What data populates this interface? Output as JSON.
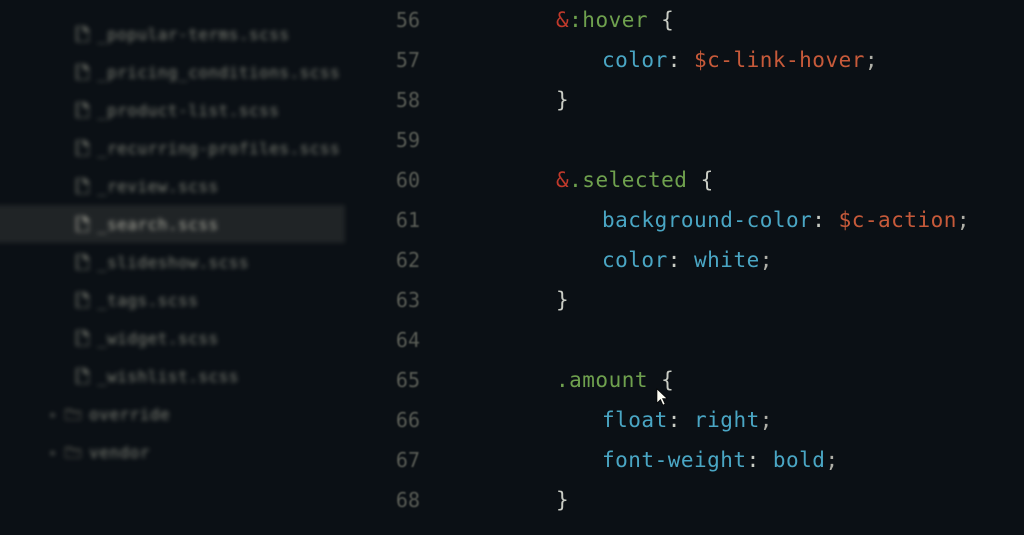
{
  "sidebar": {
    "files": [
      {
        "name": "_popular-terms.scss"
      },
      {
        "name": "_pricing_conditions.scss"
      },
      {
        "name": "_product-list.scss"
      },
      {
        "name": "_recurring-profiles.scss"
      },
      {
        "name": "_review.scss"
      },
      {
        "name": "_search.scss",
        "active": true
      },
      {
        "name": "_slideshow.scss"
      },
      {
        "name": "_tags.scss"
      },
      {
        "name": "_widget.scss"
      },
      {
        "name": "_wishlist.scss"
      }
    ],
    "folders": [
      {
        "name": "override"
      },
      {
        "name": "vendor"
      }
    ]
  },
  "line_numbers": [
    56,
    57,
    58,
    59,
    60,
    61,
    62,
    63,
    64,
    65,
    66,
    67,
    68
  ],
  "code": {
    "l56": {
      "amp": "&",
      "pseudo": ":hover",
      "brace": "{"
    },
    "l57": {
      "prop": "color",
      "colon": ": ",
      "val": "$c-link-hover",
      "semi": ";"
    },
    "l58": {
      "brace": "}"
    },
    "l60": {
      "amp": "&",
      "cls": ".selected",
      "brace": "{"
    },
    "l61": {
      "prop": "background-color",
      "colon": ": ",
      "val": "$c-action",
      "semi": ";"
    },
    "l62": {
      "prop": "color",
      "colon": ": ",
      "val": "white",
      "semi": ";"
    },
    "l63": {
      "brace": "}"
    },
    "l65": {
      "cls": ".amount",
      "brace": "{"
    },
    "l66": {
      "prop": "float",
      "colon": ": ",
      "val": "right",
      "semi": ";"
    },
    "l67": {
      "prop": "font-weight",
      "colon": ": ",
      "val": "bold",
      "semi": ";"
    },
    "l68": {
      "brace": "}"
    }
  }
}
